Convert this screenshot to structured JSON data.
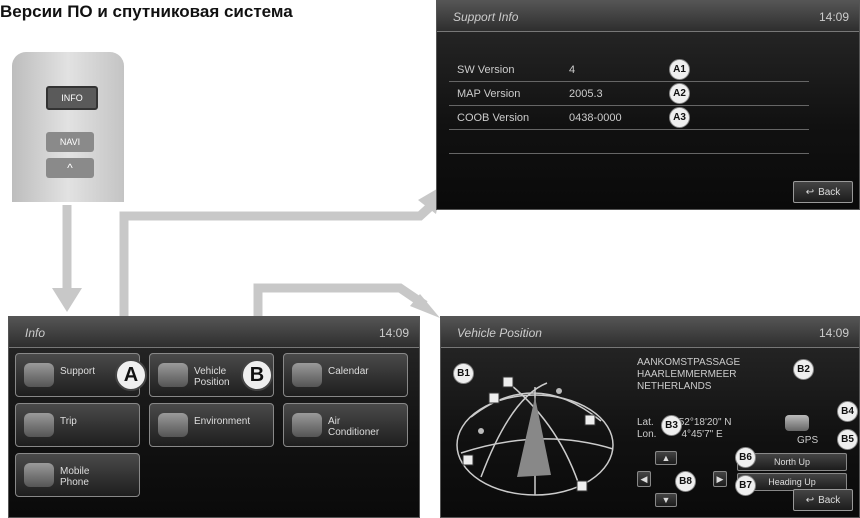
{
  "page": {
    "title": "Версии ПО и спутниковая система"
  },
  "remote": {
    "buttons": [
      {
        "label": "INFO"
      },
      {
        "label": "NAVI"
      },
      {
        "label": "^"
      }
    ]
  },
  "support_screen": {
    "title": "Support Info",
    "time": "14:09",
    "rows": [
      {
        "label": "SW Version",
        "value": "4",
        "badge": "A1"
      },
      {
        "label": "MAP Version",
        "value": "2005.3",
        "badge": "A2"
      },
      {
        "label": "COOB Version",
        "value": "0438-0000",
        "badge": "A3"
      }
    ],
    "back_label": "Back"
  },
  "info_screen": {
    "title": "Info",
    "time": "14:09",
    "buttons": [
      {
        "label": "Support",
        "icon": "support-icon"
      },
      {
        "label": "Vehicle Position",
        "icon": "satellite-icon"
      },
      {
        "label": "Calendar",
        "icon": "calendar-icon"
      },
      {
        "label": "Trip",
        "icon": "trip-icon"
      },
      {
        "label": "Environment",
        "icon": "environment-icon"
      },
      {
        "label": "Air Conditioner",
        "icon": "air-conditioner-icon"
      },
      {
        "label": "Mobile Phone",
        "icon": "phone-icon"
      }
    ],
    "callouts": [
      "A",
      "B"
    ]
  },
  "vehicle_screen": {
    "title": "Vehicle Position",
    "time": "14:09",
    "address_lines": [
      "AANKOMSTPASSAGE",
      "HAARLEMMERMEER",
      "NETHERLANDS"
    ],
    "lat_label": "Lat.",
    "lon_label": "Lon.",
    "lat_value": "52°18'20\" N",
    "lon_value": "4°45'7\" E",
    "gps_label": "GPS",
    "north_up": "North Up",
    "heading_up": "Heading Up",
    "back_label": "Back",
    "badges": [
      "B1",
      "B2",
      "B3",
      "B4",
      "B5",
      "B6",
      "B7",
      "B8"
    ]
  },
  "colors": {
    "arrow": "#c8c8c8",
    "screen_bg": "#161616",
    "badge_bg": "#efefef"
  }
}
